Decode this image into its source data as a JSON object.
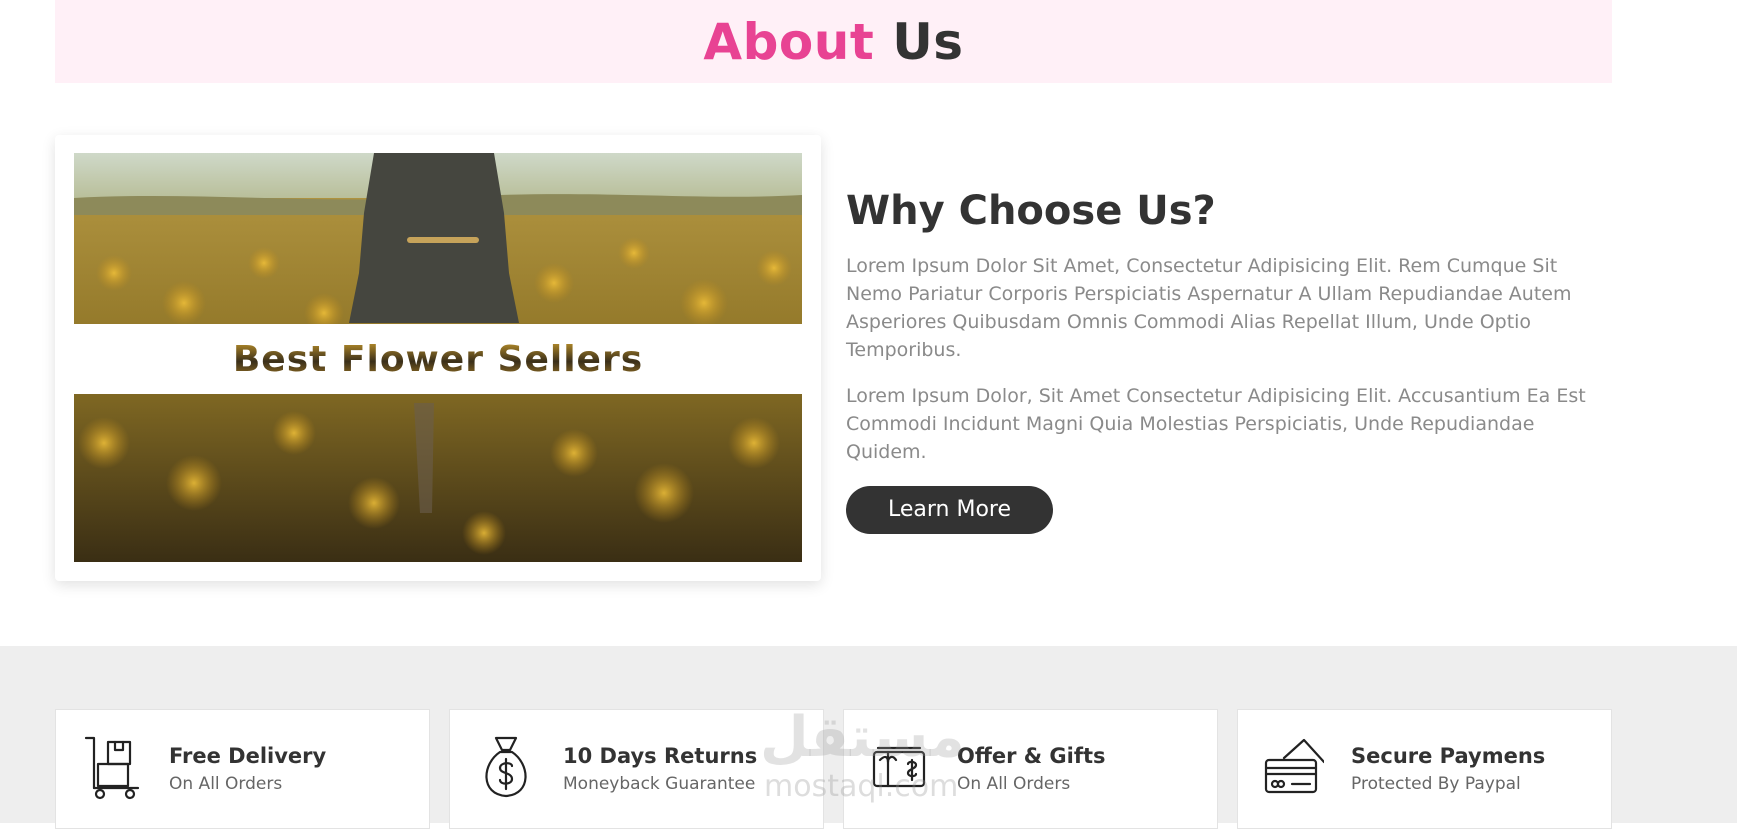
{
  "about": {
    "title_accent": "About",
    "title_rest": "Us"
  },
  "image_card": {
    "banner_text": "Best Flower Sellers"
  },
  "why": {
    "heading": "Why Choose Us?",
    "paragraph1": "Lorem Ipsum Dolor Sit Amet, Consectetur Adipisicing Elit. Rem Cumque Sit Nemo Pariatur Corporis Perspiciatis Aspernatur A Ullam Repudiandae Autem Asperiores Quibusdam Omnis Commodi Alias Repellat Illum, Unde Optio Temporibus.",
    "paragraph2": "Lorem Ipsum Dolor, Sit Amet Consectetur Adipisicing Elit. Accusantium Ea Est Commodi Incidunt Magni Quia Molestias Perspiciatis, Unde Repudiandae Quidem.",
    "button_label": "Learn More"
  },
  "features": [
    {
      "title": "Free Delivery",
      "subtitle": "On All Orders",
      "icon": "delivery-cart-icon"
    },
    {
      "title": "10 Days Returns",
      "subtitle": "Moneyback Guarantee",
      "icon": "money-bag-icon"
    },
    {
      "title": "Offer & Gifts",
      "subtitle": "On All Orders",
      "icon": "gift-card-icon"
    },
    {
      "title": "Secure Paymens",
      "subtitle": "Protected By Paypal",
      "icon": "credit-card-icon"
    }
  ],
  "watermark": {
    "arabic": "مستقل",
    "latin": "mostaql.com"
  },
  "colors": {
    "accent": "#e84393",
    "dark": "#333333",
    "band": "#fff0f7",
    "section_bg": "#eeeeee"
  }
}
